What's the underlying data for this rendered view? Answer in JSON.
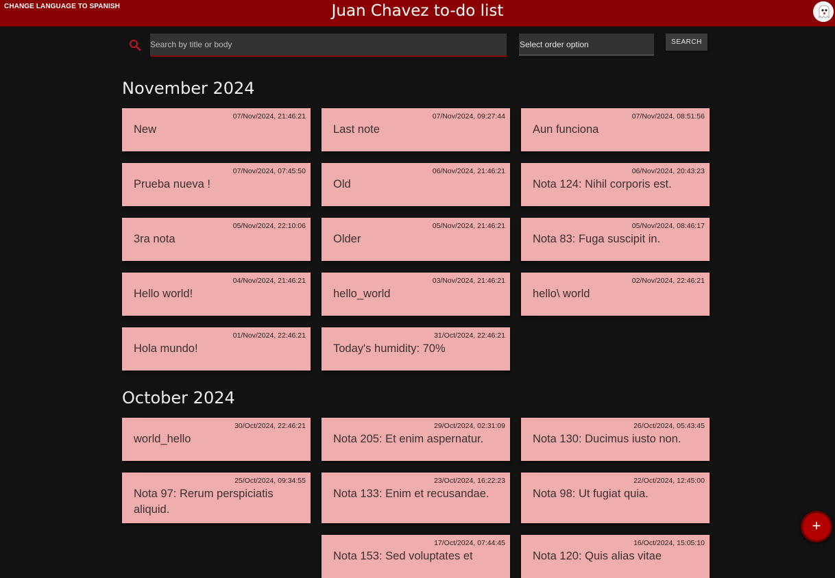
{
  "header": {
    "language_link": "CHANGE LANGUAGE TO SPANISH",
    "title": "Juan Chavez to-do list",
    "avatar_icon": "ghost-avatar-icon"
  },
  "search": {
    "placeholder": "Search by title or body",
    "order_placeholder": "Select order option",
    "button_label": "SEARCH",
    "icon": "search-icon"
  },
  "colors": {
    "accent": "#8b0000",
    "card": "#f0adae",
    "background": "#121212"
  },
  "groups": [
    {
      "month": "November 2024",
      "notes": [
        {
          "title": "New",
          "date": "07/Nov/2024, 21:46:21"
        },
        {
          "title": "Last note",
          "date": "07/Nov/2024, 09:27:44"
        },
        {
          "title": "Aun funciona",
          "date": "07/Nov/2024, 08:51:56"
        },
        {
          "title": "Prueba nueva !",
          "date": "07/Nov/2024, 07:45:50"
        },
        {
          "title": "Old",
          "date": "06/Nov/2024, 21:46:21"
        },
        {
          "title": "Nota 124: Nihil corporis est.",
          "date": "06/Nov/2024, 20:43:23"
        },
        {
          "title": "3ra nota",
          "date": "05/Nov/2024, 22:10:06"
        },
        {
          "title": "Older",
          "date": "05/Nov/2024, 21:46:21"
        },
        {
          "title": "Nota 83: Fuga suscipit in.",
          "date": "05/Nov/2024, 08:46:17"
        },
        {
          "title": "Hello world!",
          "date": "04/Nov/2024, 21:46:21"
        },
        {
          "title": "hello_world",
          "date": "03/Nov/2024, 21:46:21"
        },
        {
          "title": "hello\\ world",
          "date": "02/Nov/2024, 22:46:21"
        },
        {
          "title": "Hola mundo!",
          "date": "01/Nov/2024, 22:46:21"
        },
        {
          "title": "Today's humidity: 70%",
          "date": "31/Oct/2024, 22:46:21"
        }
      ]
    },
    {
      "month": "October 2024",
      "notes": [
        {
          "title": "world_hello",
          "date": "30/Oct/2024, 22:46:21"
        },
        {
          "title": "Nota 205: Et enim aspernatur.",
          "date": "29/Oct/2024, 02:31:09"
        },
        {
          "title": "Nota 130: Ducimus iusto non.",
          "date": "26/Oct/2024, 05:43:45"
        },
        {
          "title": "Nota 97: Rerum perspiciatis aliquid.",
          "date": "25/Oct/2024, 09:34:55"
        },
        {
          "title": "Nota 133: Enim et recusandae.",
          "date": "23/Oct/2024, 16:22:23"
        },
        {
          "title": "Nota 98: Ut fugiat quia.",
          "date": "22/Oct/2024, 12:45:00"
        },
        {
          "title": "Nota 153: Sed voluptates et",
          "date": "17/Oct/2024, 07:44:45",
          "col": 2
        },
        {
          "title": "Nota 120: Quis alias vitae",
          "date": "16/Oct/2024, 15:05:10"
        }
      ]
    }
  ],
  "fab": {
    "label": "+",
    "icon": "plus-icon"
  }
}
